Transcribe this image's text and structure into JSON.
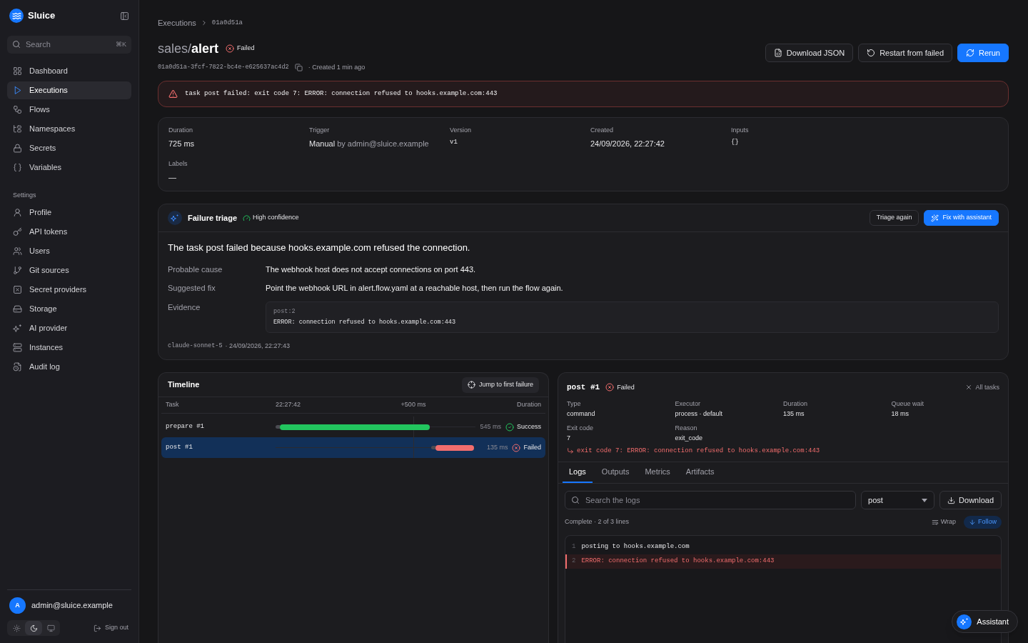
{
  "sidebar": {
    "brand": "Sluice",
    "search": {
      "placeholder": "Search",
      "shortcut": "⌘K"
    },
    "nav": [
      {
        "label": "Dashboard",
        "selected": false
      },
      {
        "label": "Executions",
        "selected": true
      },
      {
        "label": "Flows",
        "selected": false
      },
      {
        "label": "Namespaces",
        "selected": false
      },
      {
        "label": "Secrets",
        "selected": false
      },
      {
        "label": "Variables",
        "selected": false
      }
    ],
    "settings_heading": "Settings",
    "settings": [
      {
        "label": "Profile",
        "selected": false
      },
      {
        "label": "API tokens",
        "selected": false
      },
      {
        "label": "Users",
        "selected": false
      },
      {
        "label": "Git sources",
        "selected": false
      },
      {
        "label": "Secret providers",
        "selected": false
      },
      {
        "label": "Storage",
        "selected": false
      },
      {
        "label": "AI provider",
        "selected": false
      },
      {
        "label": "Instances",
        "selected": false
      },
      {
        "label": "Audit log",
        "selected": false
      }
    ],
    "user": {
      "avatar": "A",
      "email": "admin@sluice.example"
    },
    "theme_modes": [
      {
        "selected": false
      },
      {
        "selected": true
      },
      {
        "selected": false
      }
    ],
    "sign_out": "Sign out"
  },
  "breadcrumb": [
    "Executions",
    "01a0d51a"
  ],
  "execution": {
    "namespace": "sales/",
    "flow": "alert",
    "status": {
      "kind": "failed",
      "label": "Failed"
    },
    "id": "01a0d51a-3fcf-7822-bc4e-e625637ac4d2",
    "created": "· Created 1 min ago"
  },
  "actions": [
    {
      "label": "Download JSON",
      "kind": "secondary"
    },
    {
      "label": "Restart from failed",
      "kind": "secondary"
    },
    {
      "label": "Rerun",
      "kind": "primary"
    }
  ],
  "alert": "task post failed: exit code 7: ERROR: connection refused to hooks.example.com:443",
  "summary": [
    {
      "label": "Duration",
      "value": "725 ms",
      "kind": "text"
    },
    {
      "label": "Trigger",
      "value": "Manual",
      "detail": "by admin@sluice.example",
      "kind": "text"
    },
    {
      "label": "Version",
      "value": "v1",
      "kind": "code"
    },
    {
      "label": "Created",
      "value": "24/09/2026, 22:27:42",
      "kind": "text"
    },
    {
      "label": "Inputs",
      "value": "{}",
      "kind": "code"
    },
    {
      "label": "Labels",
      "value": "—",
      "kind": "text"
    }
  ],
  "triage": {
    "title": "Failure triage",
    "confidence": "High confidence",
    "actions": [
      {
        "label": "Triage again",
        "kind": "secondary"
      },
      {
        "label": "Fix with assistant",
        "kind": "primary"
      }
    ],
    "summary": "The task post failed because hooks.example.com refused the connection.",
    "rows": [
      {
        "label": "Probable cause",
        "value": "The webhook host does not accept connections on port 443."
      },
      {
        "label": "Suggested fix",
        "value": "Point the webhook URL in alert.flow.yaml at a reachable host, then run the flow again."
      }
    ],
    "evidence": {
      "label": "Evidence",
      "source": "post:2",
      "line": "ERROR: connection refused to hooks.example.com:443"
    },
    "model": "claude-sonnet-5",
    "time": "· 24/09/2026, 22:27:43"
  },
  "timeline": {
    "title": "Timeline",
    "jump": "Jump to first failure",
    "columns": [
      "Task",
      "22:27:42",
      "+500 ms",
      "Duration"
    ],
    "rows": [
      {
        "task": "prepare #1",
        "level": 0.75,
        "duration": "545 ms",
        "status": {
          "kind": "success",
          "label": "Success"
        },
        "selected": false
      },
      {
        "task": "post #1",
        "level": 0.19,
        "duration": "135 ms",
        "status": {
          "kind": "failed",
          "label": "Failed"
        },
        "selected": true
      }
    ]
  },
  "details": {
    "task": "post #1",
    "status": {
      "kind": "failed",
      "label": "Failed"
    },
    "close": "All tasks",
    "fields": [
      {
        "label": "Type",
        "value": "command"
      },
      {
        "label": "Executor",
        "value": "process · default"
      },
      {
        "label": "Duration",
        "value": "135 ms"
      },
      {
        "label": "Queue wait",
        "value": "18 ms"
      },
      {
        "label": "Exit code",
        "value": "7"
      },
      {
        "label": "Reason",
        "value": "exit_code"
      }
    ],
    "error": "exit code 7: ERROR: connection refused to hooks.example.com:443",
    "tabs": [
      {
        "label": "Logs",
        "selected": true
      },
      {
        "label": "Outputs",
        "selected": false
      },
      {
        "label": "Metrics",
        "selected": false
      },
      {
        "label": "Artifacts",
        "selected": false
      }
    ],
    "log_search": {
      "placeholder": "Search the logs"
    },
    "task_filter": "post",
    "download": "Download",
    "log_status": "Complete · 2 of 3 lines",
    "wrap": {
      "label": "Wrap",
      "on": false
    },
    "follow": {
      "label": "Follow",
      "on": true
    },
    "lines": [
      {
        "number": "1",
        "text": "posting to hooks.example.com",
        "kind": "info"
      },
      {
        "number": "2",
        "text": "ERROR: connection refused to hooks.example.com:443",
        "kind": "error"
      }
    ]
  },
  "assistant": "Assistant"
}
